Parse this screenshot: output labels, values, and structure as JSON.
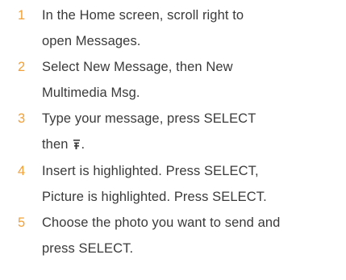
{
  "accent_color": "#f2a13a",
  "text_color": "#3a3a3a",
  "steps": [
    {
      "number": "1",
      "line1": "In the Home screen, scroll right to",
      "line2": "open Messages."
    },
    {
      "number": "2",
      "line1": "Select New Message, then New",
      "line2": "Multimedia Msg."
    },
    {
      "number": "3",
      "line1": "Type your message, press SELECT",
      "line2_before_icon": "then",
      "icon": "menu-options-icon",
      "line2_after_icon": "."
    },
    {
      "number": "4",
      "line1": "Insert is highlighted. Press SELECT,",
      "line2": "Picture is highlighted. Press SELECT."
    },
    {
      "number": "5",
      "line1": "Choose the photo you want to send and",
      "line2": "press SELECT."
    }
  ]
}
